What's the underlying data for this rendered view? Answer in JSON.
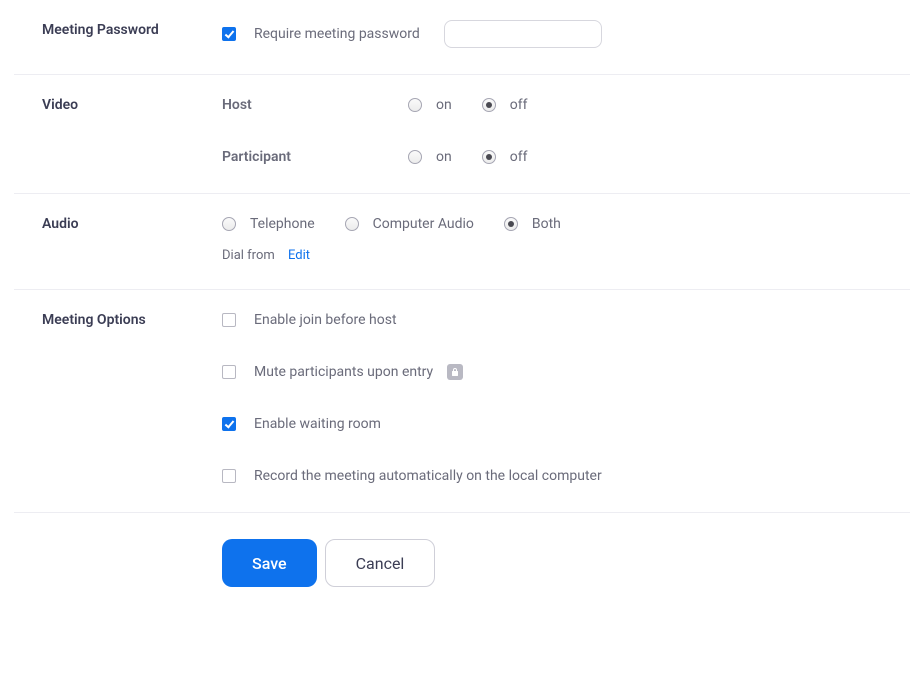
{
  "password": {
    "section_label": "Meeting Password",
    "require_label": "Require meeting password",
    "require_checked": true,
    "value": ""
  },
  "video": {
    "section_label": "Video",
    "host_label": "Host",
    "participant_label": "Participant",
    "on_label": "on",
    "off_label": "off",
    "host_value": "off",
    "participant_value": "off"
  },
  "audio": {
    "section_label": "Audio",
    "telephone_label": "Telephone",
    "computer_label": "Computer Audio",
    "both_label": "Both",
    "value": "both",
    "dial_from_label": "Dial from",
    "edit_label": "Edit"
  },
  "options": {
    "section_label": "Meeting Options",
    "join_before_host": {
      "label": "Enable join before host",
      "checked": false
    },
    "mute_on_entry": {
      "label": "Mute participants upon entry",
      "checked": false,
      "locked": true
    },
    "waiting_room": {
      "label": "Enable waiting room",
      "checked": true
    },
    "auto_record": {
      "label": "Record the meeting automatically on the local computer",
      "checked": false
    }
  },
  "buttons": {
    "save": "Save",
    "cancel": "Cancel"
  }
}
